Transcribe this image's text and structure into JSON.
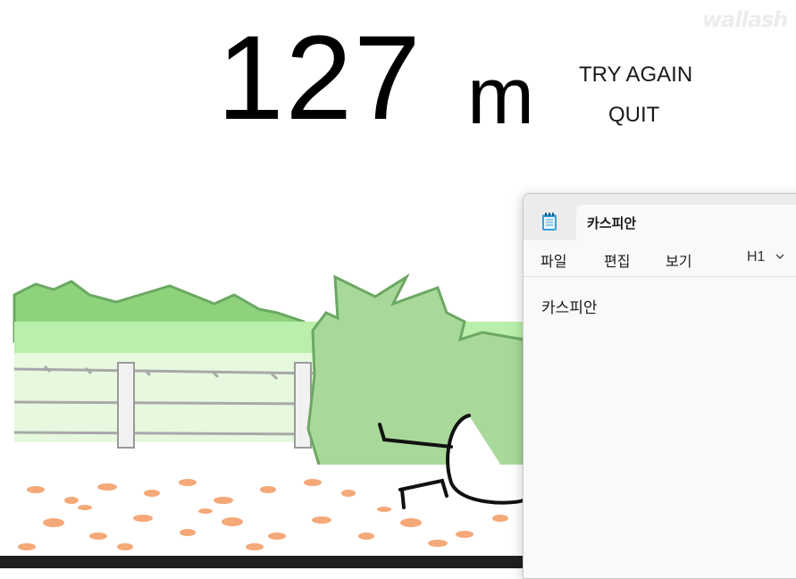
{
  "game": {
    "distance_value": "127",
    "distance_unit": "m",
    "try_again_label": "TRY AGAIN",
    "quit_label": "QUIT",
    "watermark": "wallash",
    "colors": {
      "grass": "#9fe08f",
      "bush": "#a9d99a",
      "bush_outline": "#6ba862",
      "leaves": "#f5a878",
      "fence": "#b0b0b0"
    }
  },
  "notepad": {
    "icon": "notepad-icon",
    "tab_title": "카스피안",
    "menu": {
      "file": "파일",
      "edit": "편집",
      "view": "보기"
    },
    "heading_select": "H1",
    "content": "카스피안"
  }
}
